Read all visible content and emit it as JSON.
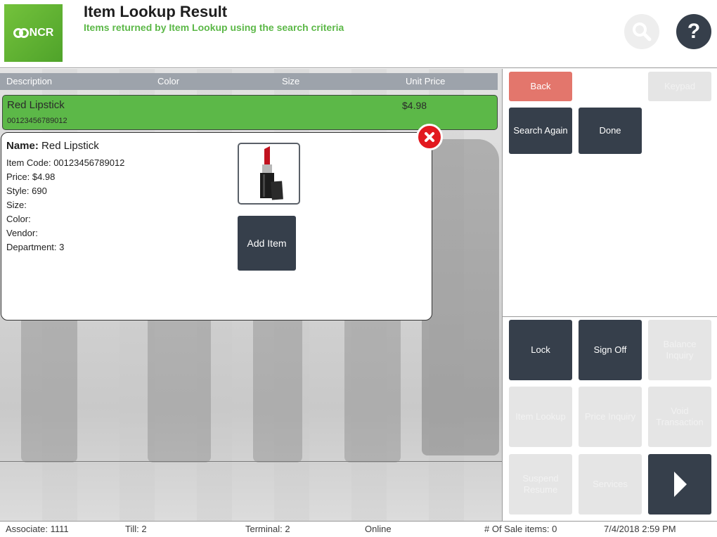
{
  "header": {
    "logo_text": "NCR",
    "title": "Item Lookup Result",
    "subtitle": "Items returned by Item Lookup using the search criteria",
    "help_label": "?"
  },
  "grid": {
    "columns": [
      "Description",
      "Color",
      "Size",
      "Unit Price"
    ]
  },
  "result": {
    "name": "Red Lipstick",
    "code": "00123456789012",
    "price": "$4.98"
  },
  "detail": {
    "name_label": "Name:",
    "name_value": "Red Lipstick",
    "item_code": "Item Code: 00123456789012",
    "price": "Price: $4.98",
    "style": "Style: 690",
    "size": "Size:",
    "color": "Color:",
    "vendor": "Vendor:",
    "department": "Department: 3",
    "add_item_label": "Add Item"
  },
  "buttons": {
    "back": "Back",
    "keypad": "Keypad",
    "search_again": "Search Again",
    "done": "Done",
    "lock": "Lock",
    "sign_off": "Sign Off",
    "balance_inquiry": "Balance Inquiry",
    "item_lookup": "Item Lookup",
    "price_inquiry": "Price Inquiry",
    "void_transaction": "Void Transaction",
    "suspend_resume": "Suspend Resume",
    "services": "Services"
  },
  "status": {
    "associate": "Associate: 1111",
    "till": "Till: 2",
    "terminal": "Terminal: 2",
    "connection": "Online",
    "sale_items": "# Of Sale items: 0",
    "datetime": "7/4/2018 2:59 PM"
  },
  "colors": {
    "brand_green": "#5cb848",
    "dark_button": "#363f4b",
    "back_button": "#e3766c",
    "close_red": "#e2191f"
  },
  "icons": [
    "search-icon",
    "help-icon",
    "close-icon",
    "next-arrow-icon"
  ]
}
